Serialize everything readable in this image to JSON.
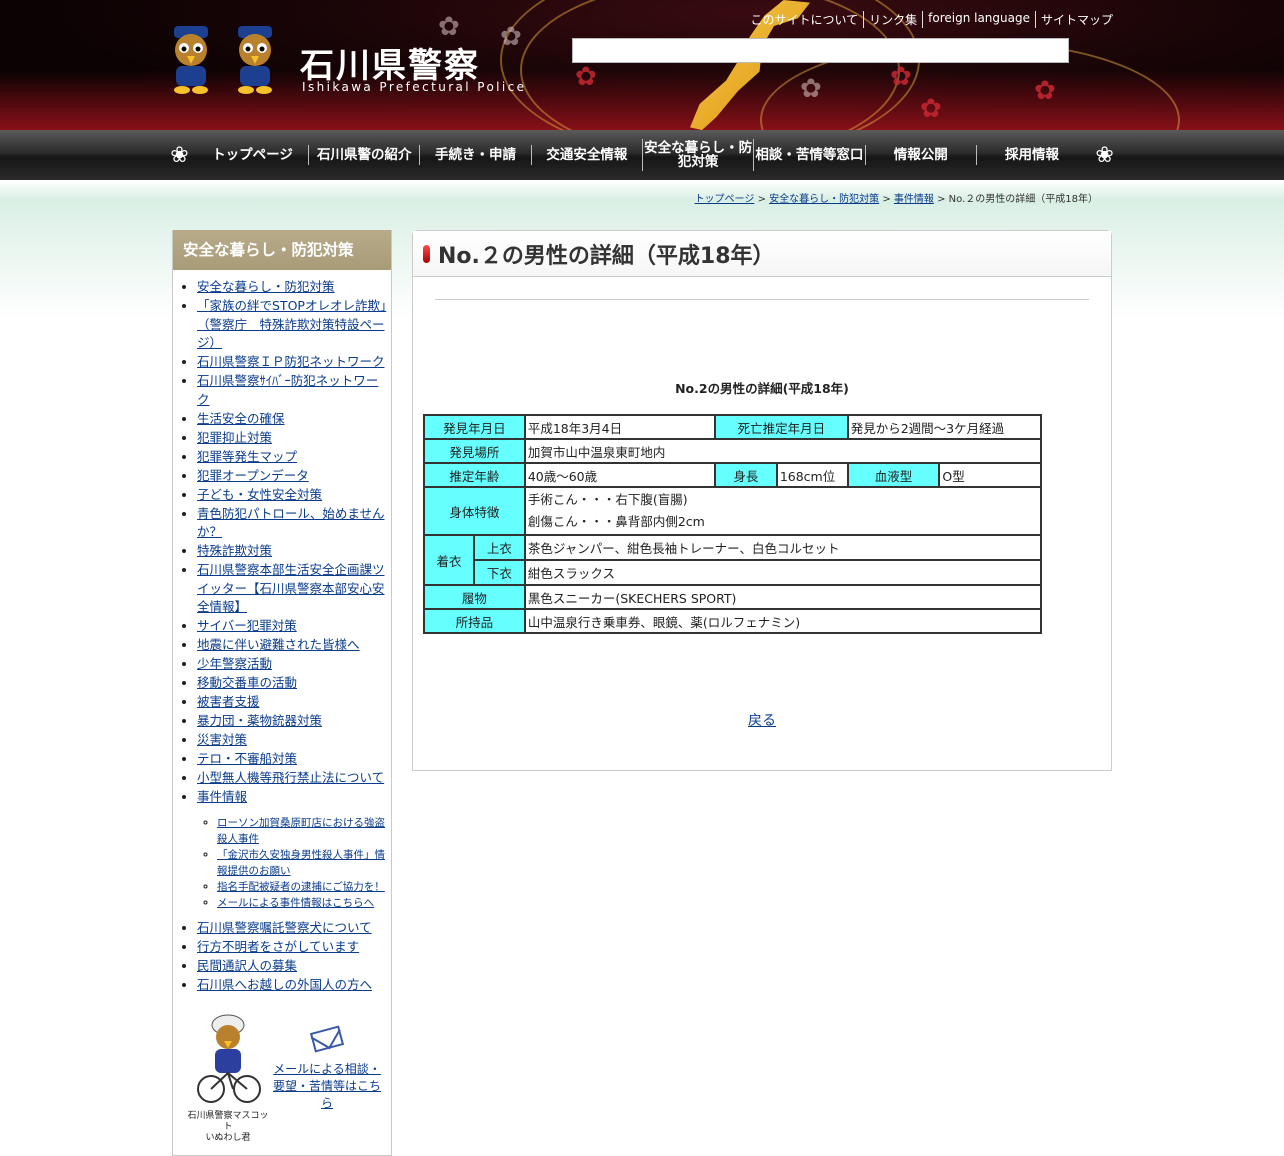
{
  "header": {
    "site_title": "石川県警察",
    "site_subtitle": "Ishikawa Prefectural Police",
    "top_links": [
      "このサイトについて",
      "リンク集",
      "foreign language",
      "サイトマップ"
    ],
    "search_placeholder": ""
  },
  "nav": {
    "items": [
      "トップページ",
      "石川県警の紹介",
      "手続き・申請",
      "交通安全情報",
      "安全な暮らし・防犯対策",
      "相談・苦情等窓口",
      "情報公開",
      "採用情報"
    ]
  },
  "breadcrumb": {
    "items": [
      "トップページ",
      "安全な暮らし・防犯対策",
      "事件情報"
    ],
    "current": "No.２の男性の詳細（平成18年）",
    "separator": ">"
  },
  "sidebar": {
    "heading": "安全な暮らし・防犯対策",
    "items": [
      "安全な暮らし・防犯対策",
      "「家族の絆でSTOPオレオレ詐欺」（警察庁　特殊詐欺対策特設ページ）",
      "石川県警察ＩＰ防犯ネットワーク",
      "石川県警察ｻｲﾊﾞｰ防犯ネットワーク",
      "生活安全の確保",
      "犯罪抑止対策",
      "犯罪等発生マップ",
      "犯罪オープンデータ",
      "子ども・女性安全対策",
      "青色防犯パトロール、始めませんか？",
      "特殊詐欺対策",
      "石川県警察本部生活安全企画課ツイッター【石川県警察本部安心安全情報】",
      "サイバー犯罪対策",
      "地震に伴い避難された皆様へ",
      "少年警察活動",
      "移動交番車の活動",
      "被害者支援",
      "暴力団・薬物銃器対策",
      "災害対策",
      "テロ・不審船対策",
      "小型無人機等飛行禁止法について",
      "事件情報"
    ],
    "sub_items": [
      "ローソン加賀桑原町店における強盗殺人事件",
      "「金沢市久安独身男性殺人事件」情報提供のお願い",
      "指名手配被疑者の逮捕にご協力を！",
      "メールによる事件情報はこちらへ"
    ],
    "items_after": [
      "石川県警察嘱託警察犬について",
      "行方不明者をさがしています",
      "民間通訳人の募集",
      "石川県へお越しの外国人の方へ"
    ],
    "mascot_caption": "石川県警察マスコット\nいぬわし君",
    "mail_link": "メールによる相談・要望・苦情等はこちら"
  },
  "main": {
    "title": "No.２の男性の詳細（平成18年）",
    "subtitle": "No.2の男性の詳細(平成18年)",
    "table": {
      "found_date_label": "発見年月日",
      "found_date": "平成18年3月4日",
      "death_label": "死亡推定年月日",
      "death_value": "発見から2週間〜3ケ月経過",
      "place_label": "発見場所",
      "place_value": "加賀市山中温泉東町地内",
      "age_label": "推定年齢",
      "age_value": "40歳〜60歳",
      "height_label": "身長",
      "height_value": "168cm位",
      "blood_label": "血液型",
      "blood_value": "O型",
      "features_label": "身体特徴",
      "features_line1": "手術こん・・・右下腹(盲腸)",
      "features_line2": "創傷こん・・・鼻背部内側2cm",
      "clothes_label": "着衣",
      "upper_label": "上衣",
      "upper_value": "茶色ジャンパー、紺色長袖トレーナー、白色コルセット",
      "lower_label": "下衣",
      "lower_value": "紺色スラックス",
      "shoes_label": "履物",
      "shoes_value": "黒色スニーカー(SKECHERS SPORT)",
      "belongings_label": "所持品",
      "belongings_value": "山中温泉行き乗車券、眼鏡、薬(ロルフェナミン)"
    },
    "back_link": "戻る"
  },
  "colors": {
    "header_red": "#8b1219",
    "table_header": "#66ffff",
    "link": "#0b3c8c",
    "sidebar_head": "#a89b78"
  }
}
